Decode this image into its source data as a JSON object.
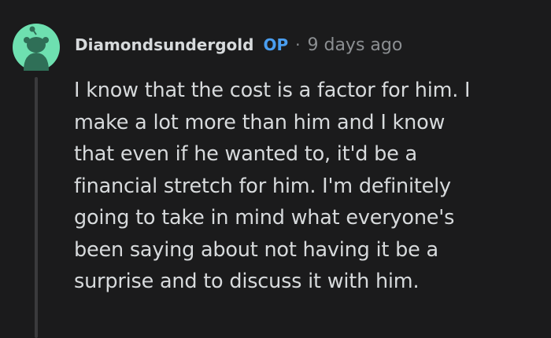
{
  "comment": {
    "author": "Diamondsundergold",
    "badge": "OP",
    "separator": "·",
    "timestamp": "9 days ago",
    "lines": [
      "I know that the cost is a factor for him. I",
      "make a lot more than him and I know",
      "that even if he wanted to, it'd be a",
      "financial stretch for him. I'm definitely",
      "going to take in mind what everyone's",
      "been saying about not having it be a",
      "surprise and to discuss it with him."
    ]
  },
  "colors": {
    "background": "#1b1b1c",
    "text": "#d7dadc",
    "muted": "#8c8f92",
    "op": "#4a9ef0",
    "avatar_bg": "#6ee0b0",
    "avatar_figure": "#2f6f57"
  },
  "icons": {
    "avatar": "snoo-avatar-icon"
  }
}
